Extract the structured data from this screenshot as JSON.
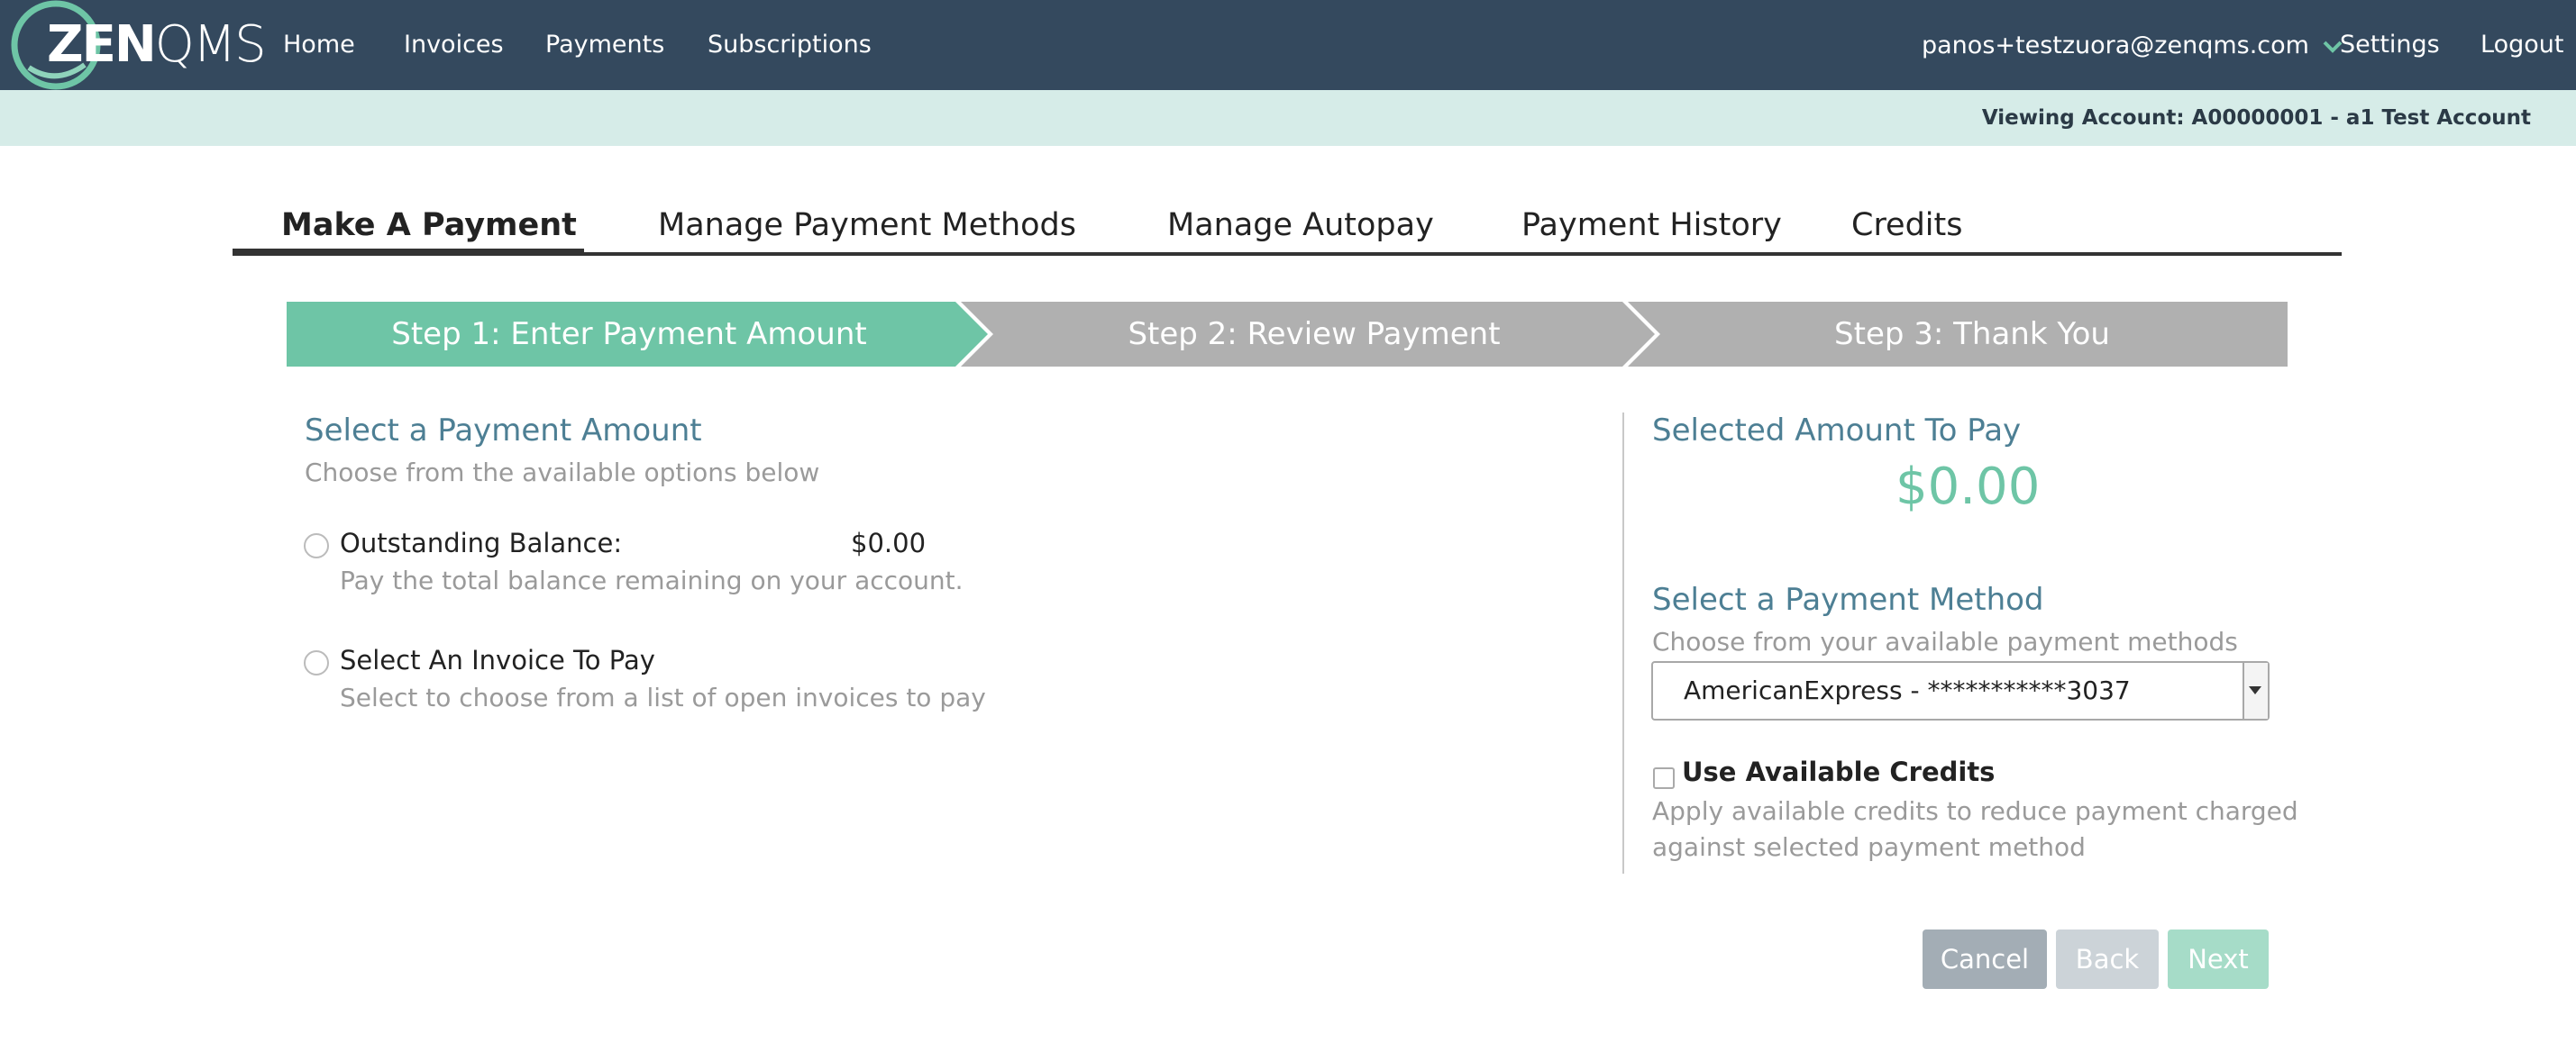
{
  "brand": {
    "logo_bold": "ZEN",
    "logo_light": "QMS"
  },
  "nav": {
    "links": [
      "Home",
      "Invoices",
      "Payments",
      "Subscriptions"
    ],
    "user_email": "panos+testzuora@zenqms.com",
    "settings": "Settings",
    "logout": "Logout"
  },
  "account_bar": {
    "text": "Viewing Account: A00000001 - a1 Test Account"
  },
  "tabs": [
    {
      "label": "Make A Payment",
      "active": true
    },
    {
      "label": "Manage Payment Methods",
      "active": false
    },
    {
      "label": "Manage Autopay",
      "active": false
    },
    {
      "label": "Payment History",
      "active": false
    },
    {
      "label": "Credits",
      "active": false
    }
  ],
  "steps": [
    {
      "label": "Step 1: Enter Payment Amount",
      "state": "active"
    },
    {
      "label": "Step 2: Review Payment",
      "state": "inactive"
    },
    {
      "label": "Step 3: Thank You",
      "state": "inactive"
    }
  ],
  "payment_amount": {
    "heading": "Select a Payment Amount",
    "subheading": "Choose from the available options below",
    "options": [
      {
        "label": "Outstanding Balance:",
        "value": "$0.00",
        "description": "Pay the total balance remaining on your account.",
        "selected": false
      },
      {
        "label": "Select An Invoice To Pay",
        "description": "Select to choose from a list of open invoices to pay",
        "selected": false
      }
    ]
  },
  "summary": {
    "heading": "Selected Amount To Pay",
    "amount": "$0.00"
  },
  "payment_method": {
    "heading": "Select a Payment Method",
    "subheading": "Choose from your available payment methods",
    "selected": "AmericanExpress - ***********3037"
  },
  "credits": {
    "checkbox_label": "Use Available Credits",
    "checked": false,
    "description_line1": "Apply available credits to reduce payment charged",
    "description_line2": "against selected payment method"
  },
  "buttons": {
    "cancel": "Cancel",
    "back": "Back",
    "next": "Next"
  },
  "colors": {
    "navbar": "#34495e",
    "account_bar": "#d6ece8",
    "accent_green": "#6ec5a6",
    "step_inactive": "#b0b0b0",
    "heading_blue": "#4d7f94",
    "button_cancel": "#a3adb5",
    "button_back": "#ccd3d8",
    "button_next": "#a6dcc8"
  },
  "icons": {
    "user_dropdown": "chevron-down-icon",
    "select_dropdown": "caret-down-icon",
    "logo": "circle-logo-icon"
  }
}
